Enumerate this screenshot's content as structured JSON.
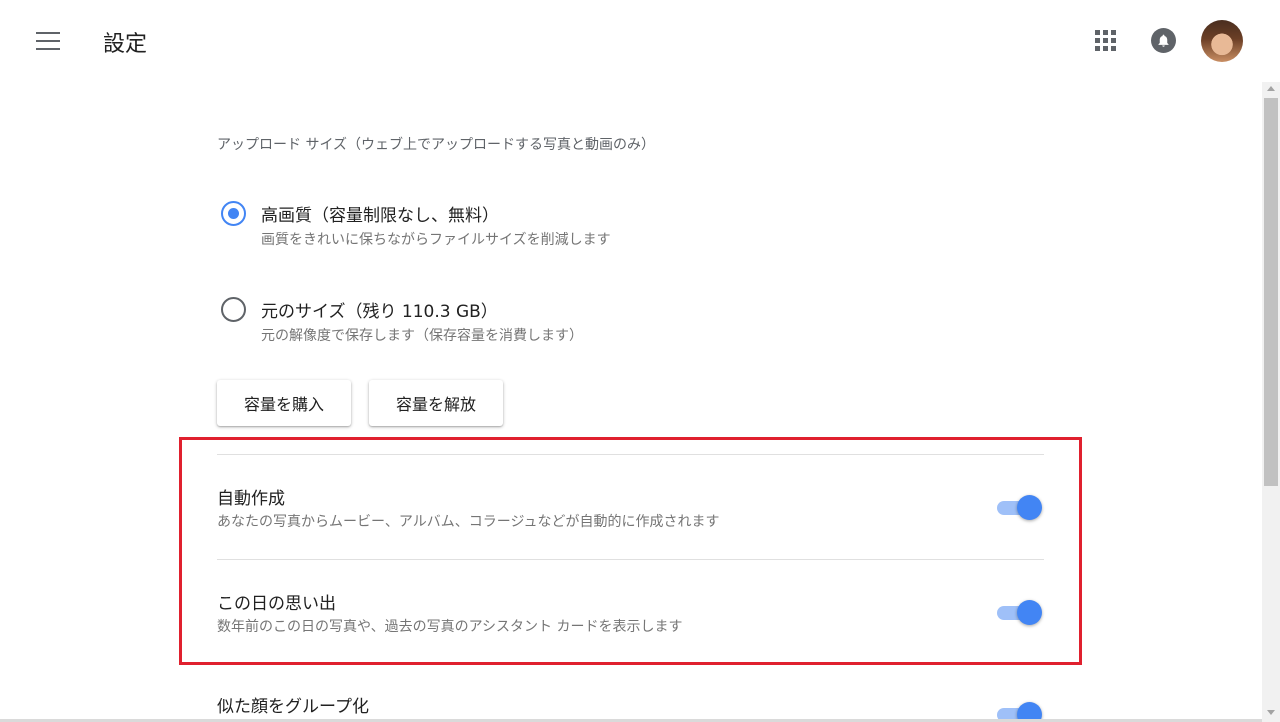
{
  "header": {
    "title": "設定"
  },
  "upload_size": {
    "label": "アップロード サイズ（ウェブ上でアップロードする写真と動画のみ）",
    "options": [
      {
        "title": "高画質（容量制限なし、無料）",
        "description": "画質をきれいに保ちながらファイルサイズを削減します",
        "checked": true
      },
      {
        "title": "元のサイズ（残り 110.3 GB）",
        "description": "元の解像度で保存します（保存容量を消費します）",
        "checked": false
      }
    ],
    "buttons": {
      "buy_storage": "容量を購入",
      "free_storage": "容量を解放"
    }
  },
  "settings": [
    {
      "title": "自動作成",
      "description": "あなたの写真からムービー、アルバム、コラージュなどが自動的に作成されます",
      "enabled": true
    },
    {
      "title": "この日の思い出",
      "description": "数年前のこの日の写真や、過去の写真のアシスタント カードを表示します",
      "enabled": true
    },
    {
      "title": "似た顔をグループ化",
      "description": "",
      "enabled": true
    }
  ],
  "colors": {
    "accent": "#4285f4",
    "highlight_border": "#e0202e"
  },
  "icons": [
    "menu-icon",
    "apps-grid-icon",
    "notification-bell-icon",
    "avatar"
  ]
}
